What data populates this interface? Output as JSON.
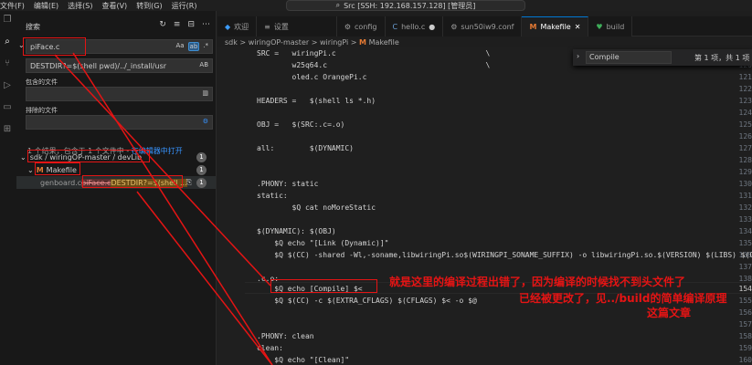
{
  "menu": [
    "文件(F)",
    "编辑(E)",
    "选择(S)",
    "查看(V)",
    "转到(G)",
    "运行(R)"
  ],
  "title_search": "Src [SSH: 192.168.157.128] [管理员]",
  "sidebar": {
    "title": "搜索",
    "search_value": "piFace.c",
    "replace_value": "DESTDIR?=$(shell pwd)/../_install/usr",
    "replace_opt": "AB",
    "include_label": "包含的文件",
    "exclude_label": "排除的文件",
    "result_info": "1 个结果，包含于 1 个文件中 - ",
    "open_in_editor": "在编辑器中打开",
    "tree": [
      {
        "label": "sdk / wiringOP-master / devLib",
        "count": "1"
      },
      {
        "label": "Makefile",
        "count": "1"
      },
      {
        "prefix": "genboard.c ",
        "match": "piFace.c",
        "replace": "DESTDIR?=$(shell ...",
        "count": "1"
      }
    ],
    "tools": [
      "↻",
      "≡",
      "⊟",
      "⋯"
    ]
  },
  "tabs": [
    {
      "label": "欢迎",
      "icon": "vscode-icon"
    },
    {
      "label": "设置",
      "icon": "gear-icon"
    },
    {
      "label": "config",
      "icon": "gear-icon"
    },
    {
      "label": "hello.c",
      "icon": "c-icon"
    },
    {
      "label": "sun50iw9.conf",
      "icon": "gear-icon"
    },
    {
      "label": "Makefile",
      "icon": "makefile-icon"
    },
    {
      "label": "build",
      "icon": "heart-icon"
    }
  ],
  "breadcrumb": [
    "sdk",
    "wiringOP-master",
    "wiringPi",
    "Makefile"
  ],
  "find_widget": {
    "value": "Compile",
    "count": "第 1 项，共 1 项"
  },
  "editor": {
    "lines": [
      {
        "n": "119",
        "t": "SRC =   wiringPi.c                                  \\"
      },
      {
        "n": "120",
        "t": "        w25q64.c                                    \\"
      },
      {
        "n": "121",
        "t": "        oled.c OrangePi.c"
      },
      {
        "n": "122",
        "t": ""
      },
      {
        "n": "123",
        "t": "HEADERS =   $(shell ls *.h)"
      },
      {
        "n": "124",
        "t": ""
      },
      {
        "n": "125",
        "t": "OBJ =   $(SRC:.c=.o)"
      },
      {
        "n": "126",
        "t": ""
      },
      {
        "n": "127",
        "t": "all:        $(DYNAMIC)"
      },
      {
        "n": "128",
        "t": ""
      },
      {
        "n": "129",
        "t": ""
      },
      {
        "n": "130",
        "t": ".PHONY: static"
      },
      {
        "n": "131",
        "t": "static:"
      },
      {
        "n": "132",
        "t": "        $Q cat noMoreStatic"
      },
      {
        "n": "133",
        "t": ""
      },
      {
        "n": "134",
        "t": "$(DYNAMIC): $(OBJ)"
      },
      {
        "n": "135",
        "t": "    $Q echo \"[Link (Dynamic)]\""
      },
      {
        "n": "136",
        "t": "    $Q $(CC) -shared -Wl,-soname,libwiringPi.so$(WIRINGPI_SONAME_SUFFIX) -o libwiringPi.so.$(VERSION) $(LIBS) $(OBJ)"
      },
      {
        "n": "137",
        "t": ""
      },
      {
        "n": "138",
        "t": ".c.o:"
      },
      {
        "n": "154",
        "t": "    $Q echo [Compile] $<"
      },
      {
        "n": "155",
        "t": "    $Q $(CC) -c $(EXTRA_CFLAGS) $(CFLAGS) $< -o $@"
      },
      {
        "n": "156",
        "t": ""
      },
      {
        "n": "157",
        "t": ""
      },
      {
        "n": "158",
        "t": ".PHONY: clean"
      },
      {
        "n": "159",
        "t": "clean:"
      },
      {
        "n": "160",
        "t": "    $Q echo \"[Clean]\""
      }
    ]
  },
  "annotation": {
    "line1": "就是这里的编译过程出错了，因为编译的时候找不到头文件了",
    "line2": "已经被更改了，见../build的简单编译原理",
    "line3": "这篇文章"
  },
  "colors": {
    "accent": "#0078d4",
    "annotation": "#e51414",
    "match_highlight": "#6b4b16"
  }
}
